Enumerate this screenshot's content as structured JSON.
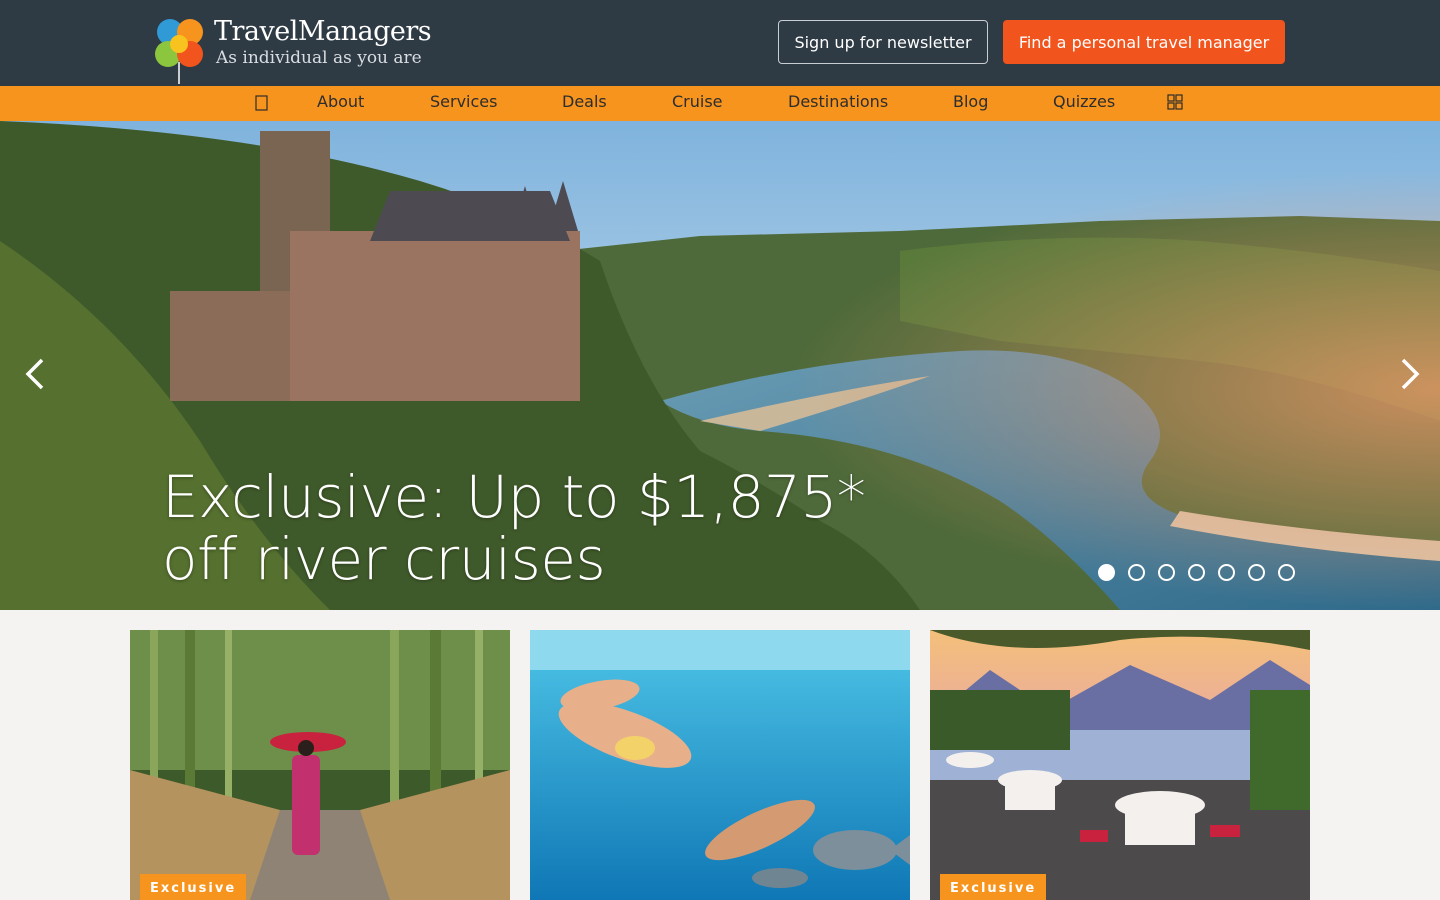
{
  "header": {
    "logo_name": "TravelManagers",
    "logo_tagline": "As individual as you are",
    "newsletter_button": "Sign up for newsletter",
    "find_manager_button": "Find a personal travel manager"
  },
  "nav": {
    "home_icon": "home-icon",
    "items": [
      "About",
      "Services",
      "Deals",
      "Cruise",
      "Destinations",
      "Blog",
      "Quizzes"
    ],
    "grid_icon": "grid-icon"
  },
  "hero": {
    "title": "Exclusive: Up to $1,875* off river cruises",
    "slide_count": 7,
    "active_slide": 1,
    "prev_icon": "chevron-left-icon",
    "next_icon": "chevron-right-icon"
  },
  "cards": [
    {
      "badge": "Exclusive"
    },
    {
      "badge": ""
    },
    {
      "badge": "Exclusive"
    }
  ],
  "colors": {
    "header_bg": "#2e3a44",
    "nav_bg": "#f7941d",
    "accent_button": "#f2541d",
    "badge_bg": "#f7941d"
  }
}
